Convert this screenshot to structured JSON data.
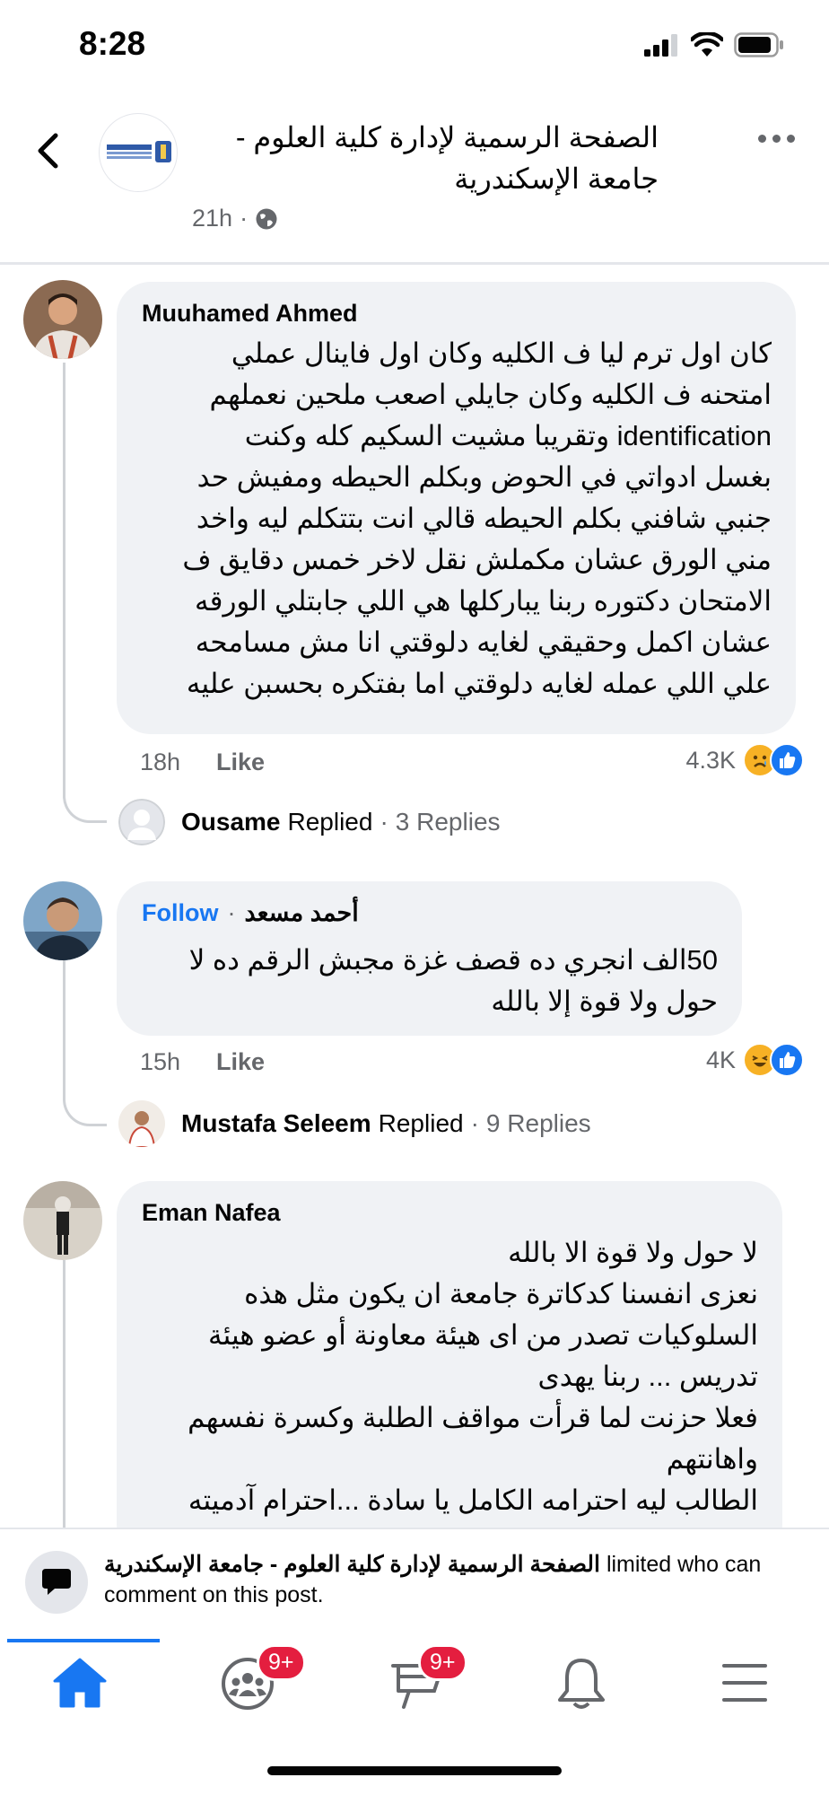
{
  "status_bar": {
    "time": "8:28"
  },
  "header": {
    "page_name": "الصفحة الرسمية لإدارة كلية العلوم - جامعة الإسكندرية",
    "time_ago": "21h",
    "separator": "·",
    "logo_text": "ALEXANDRIA"
  },
  "comments": [
    {
      "author": "Muuhamed Ahmed",
      "text": "كان اول ترم ليا ف الكليه وكان اول فاينال عملي\nامتحنه ف الكليه وكان جايلي اصعب ملحين نعملهم\nidentification وتقريبا مشيت السكيم كله وكنت\nبغسل ادواتي في الحوض وبكلم الحيطه ومفيش حد\nجنبي شافني بكلم الحيطه قالي انت بتتكلم ليه واخد\nمني الورق عشان مكملش نقل لاخر خمس دقايق ف\nالامتحان دكتوره ربنا يباركلها هي اللي جابتلي الورقه\nعشان اكمل وحقيقي لغايه دلوقتي انا مش مسامحه\nعلي اللي عمله لغايه دلوقتي اما بفتكره بحسبن عليه",
      "time": "18h",
      "like_label": "Like",
      "reaction_count": "4.3K",
      "reply_author": "Ousame",
      "replied_label": "Replied",
      "replies_count": "3 Replies"
    },
    {
      "author": "أحمد مسعد",
      "follow_label": "Follow",
      "text": "50الف انجري ده قصف غزة مجبش الرقم ده لا\nحول ولا قوة إلا بالله",
      "time": "15h",
      "like_label": "Like",
      "reaction_count": "4K",
      "reply_author": "Mustafa Seleem",
      "replied_label": "Replied",
      "replies_count": "9 Replies"
    },
    {
      "author": "Eman Nafea",
      "text": "لا حول ولا قوة الا بالله\nنعزى انفسنا كدكاترة جامعة  ان يكون مثل هذه\nالسلوكيات تصدر من اى هيئة معاونة أو عضو هيئة\nتدريس ... ربنا يهدى\nفعلا حزنت لما قرأت مواقف الطلبة وكسرة نفسهم\nواهانتهم\nالطالب ليه احترامه الكامل يا سادة ...احترام آدميته"
    }
  ],
  "banner": {
    "page_name": "الصفحة الرسمية لإدارة كلية العلوم - جامعة الإسكندرية",
    "message_tail": " limited who can",
    "message_line2": "comment on this post."
  },
  "nav": {
    "groups_badge": "9+",
    "feeds_badge": "9+"
  },
  "colors": {
    "accent": "#1877f2",
    "badge": "#e41e3f",
    "secondary_text": "#65676b",
    "bubble": "#f0f2f5"
  }
}
